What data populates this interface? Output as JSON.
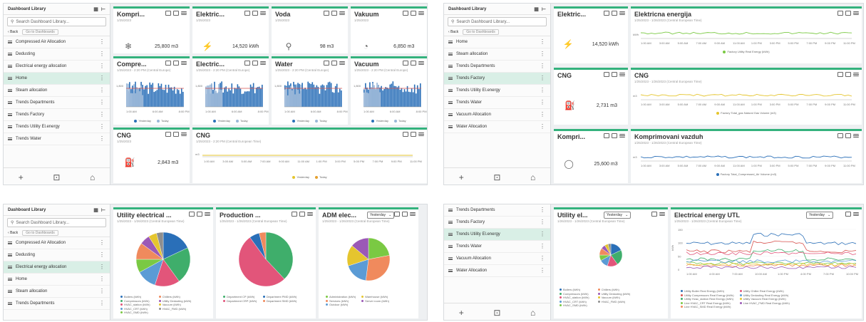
{
  "sidebar": {
    "title": "Dashboard Library",
    "search_placeholder": "Search Dashboard Library...",
    "back_label": "Back",
    "crumb": "Go to Dashboards",
    "items_q1": [
      "Compressed Air Allocation",
      "Dedusting",
      "Electrical energy allocation",
      "Home",
      "Steam allocation",
      "Trends Departments",
      "Trends Factory",
      "Trends Utility El.energy",
      "Trends Water"
    ],
    "items_q2": [
      "Home",
      "Steam allocation",
      "Trends Departments",
      "Trends Factory",
      "Trends Utility El.energy",
      "Trends Water",
      "Vacuum Allocation",
      "Water Allocation"
    ],
    "items_q3": [
      "Compressed Air Allocation",
      "Dedusting",
      "Electrical energy allocation",
      "Home",
      "Steam allocation",
      "Trends Departments"
    ],
    "items_q4": [
      "Trends Departments",
      "Trends Factory",
      "Trends Utility El.energy",
      "Trends Water",
      "Vacuum Allocation",
      "Water Allocation"
    ]
  },
  "q1": {
    "kpis": [
      {
        "title": "Kompri...",
        "value": "25,800 m3",
        "icon": "snowflake"
      },
      {
        "title": "Elektric...",
        "value": "14,520 kWh",
        "icon": "bolt"
      },
      {
        "title": "Voda",
        "value": "98 m3",
        "icon": "tap"
      },
      {
        "title": "Vakuum",
        "value": "6,850 m3",
        "icon": "gauge"
      }
    ],
    "trends": [
      {
        "title": "Compre...",
        "sub": "1/25/2023 - 2:20 PM (Central Europe)"
      },
      {
        "title": "Electric...",
        "sub": "1/25/2023 - 2:20 PM (Central Europe)"
      },
      {
        "title": "Water",
        "sub": "1/25/2023 - 2:20 PM (Central Europe)"
      },
      {
        "title": "Vacuum",
        "sub": "1/25/2023 - 2:20 PM (Central Europe)"
      }
    ],
    "trend_ylabel": "1,800",
    "trend_xticks": [
      "1:00 AM",
      "6:00 AM",
      "8:00 PM"
    ],
    "legend_yesterday": "Yesterday",
    "legend_today": "Today",
    "cng_title": "CNG",
    "cng_value": "2,843 m3",
    "cng_trend_title": "CNG",
    "cng_trend_sub": "1/25/2023 - 2:20 PM (Central European Time)",
    "cng_xticks": [
      "1:00 AM",
      "3:00 AM",
      "5:00 AM",
      "7:00 AM",
      "9:00 AM",
      "11:00 AM",
      "1:00 PM",
      "3:00 PM",
      "5:00 PM",
      "7:00 PM",
      "9:00 PM",
      "11:00 PM"
    ]
  },
  "q2": {
    "kpis": [
      {
        "title": "Elektric...",
        "value": "14,520 kWh"
      },
      {
        "title": "CNG",
        "value": "2,731 m3"
      },
      {
        "title": "Kompri...",
        "value": "25,600 m3"
      }
    ],
    "trends": [
      {
        "title": "Elektricna energija",
        "sub": "1/25/2023 - 1/26/2023 (Central European Time)",
        "legend": "Factory Utility Real Energy (kWh)"
      },
      {
        "title": "CNG",
        "sub": "1/25/2023 - 1/26/2023 (Central European Time)",
        "legend": "Factory Total_gas Natural Gas Volume (m3)"
      },
      {
        "title": "Komprimovani vazduh",
        "sub": "1/25/2023 - 1/26/2023 (Central European Time)",
        "legend": "Factory Total_Compressed_Air Volume (m3)"
      }
    ],
    "xticks": [
      "1:00 AM",
      "3:00 AM",
      "5:00 AM",
      "7:00 AM",
      "9:00 AM",
      "11:00 AM",
      "1:00 PM",
      "3:00 PM",
      "5:00 PM",
      "7:00 PM",
      "9:00 PM",
      "11:00 PM"
    ]
  },
  "q3": {
    "pies": [
      {
        "title": "Utility electrical ...",
        "sub": "1/25/2023 - 1/26/2023 (Central European Time)",
        "legend": [
          "Boilers (kWh)",
          "Compressors (kWh)",
          "HVAC_station (kWh)",
          "HVAC_CRT (kWh)",
          "HVAC_SMD (kWh)",
          "Chillers (kWh)",
          "Utility Dedusting (kWh)",
          "Vacuum (kWh)",
          "HVAC_FMD (kWh)"
        ]
      },
      {
        "title": "Production ...",
        "sub": "1/25/2023 - 1/26/2023 (Central European Time)",
        "legend": [
          "Department CP (kWh)",
          "Department CRP (kWh)",
          "Department PMD (kWh)",
          "Department SMD (kWh)"
        ]
      },
      {
        "title": "ADM elec...",
        "sub": "1/25/2023 - 1/26/2023 (Central European Time)",
        "legend": [
          "Administration (kWh)",
          "Services (kWh)",
          "Outdoor (kWh)",
          "Warehouse (kWh)",
          "Server room (kWh)"
        ]
      }
    ],
    "dropdown": "Yesterday"
  },
  "q4": {
    "pie_title": "Utility el...",
    "pie_sub": "1/26/2023 - 1/26/2023 (Central European Time)",
    "dropdown": "Yesterday",
    "pie_legend": [
      "Boilers (kWh)",
      "Compressors (kWh)",
      "HVAC_station (kWh)",
      "HVAC_CRT (kWh)",
      "HVAC_SMD (kWh)",
      "Chillers (kWh)",
      "Utility Dedusting (kWh)",
      "Vacuum (kWh)",
      "HVAC_FMD (kWh)"
    ],
    "line_title": "Electrical energy UTL",
    "line_sub": "1/25/2023 - 1/26/2023 (Central European Time)",
    "yticks": [
      "150",
      "100",
      "50",
      "0"
    ],
    "ylabel": "kWh",
    "xticks": [
      "1:00 AM",
      "4:00 AM",
      "7:00 AM",
      "10:00 AM",
      "1:00 PM",
      "4:00 PM",
      "7:00 PM",
      "10:00 PM"
    ],
    "line_legend": [
      "Utility Boiler Real Energy (kWh)",
      "Utility Compressors Real Energy (kWh)",
      "Utility Hvac_station Real Energy (kWh)",
      "Line HVAC_CRT Real Energy (kWh)",
      "Line HVAC_SMD Real Energy (kWh)",
      "Utility Chiller Real Energy (kWh)",
      "Utility Dedusting Real Energy (kWh)",
      "Utility Vacuum Real Energy (kWh)",
      "Line HVAC_FMD Real Energy (kWh)"
    ]
  },
  "colors": {
    "accent": "#34b27d",
    "active_row": "#d9efe6",
    "series_blue": "#2a6fb8",
    "series_red": "#d9534f",
    "series_green": "#7ac943",
    "series_yellow": "#e5c52e"
  }
}
